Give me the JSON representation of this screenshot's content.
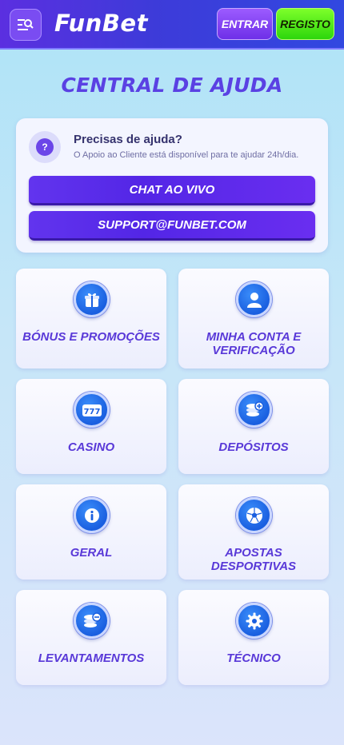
{
  "header": {
    "brand": "FunBet",
    "login_label": "ENTRAR",
    "register_label": "REGISTO"
  },
  "page_title": "CENTRAL DE AJUDA",
  "help": {
    "title": "Precisas de ajuda?",
    "subtitle": "O Apoio ao Cliente está disponível para te ajudar 24h/dia.",
    "chat_label": "CHAT AO VIVO",
    "email_label": "SUPPORT@FUNBET.COM"
  },
  "categories": [
    {
      "label": "BÓNUS E PROMOÇÕES",
      "icon": "gift-icon"
    },
    {
      "label": "MINHA CONTA E VERIFICAÇÃO",
      "icon": "user-icon"
    },
    {
      "label": "CASINO",
      "icon": "slot-machine-icon"
    },
    {
      "label": "DEPÓSITOS",
      "icon": "coins-plus-icon"
    },
    {
      "label": "GERAL",
      "icon": "info-icon"
    },
    {
      "label": "APOSTAS DESPORTIVAS",
      "icon": "soccer-ball-icon"
    },
    {
      "label": "LEVANTAMENTOS",
      "icon": "coins-minus-icon"
    },
    {
      "label": "TÉCNICO",
      "icon": "gear-icon"
    }
  ]
}
